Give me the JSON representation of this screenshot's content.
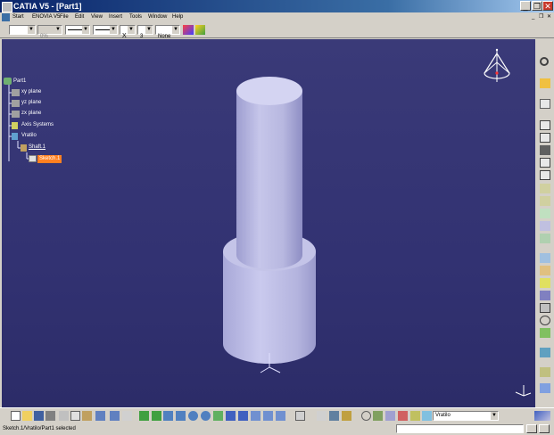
{
  "window": {
    "title": "CATIA V5 - [Part1]",
    "minimize_label": "_",
    "restore_label": "❐",
    "close_label": "✕",
    "doc_minimize_label": "_",
    "doc_restore_label": "❐",
    "doc_close_label": "✕"
  },
  "menu": {
    "items": [
      "Start",
      "ENOVIA V5",
      "File",
      "Edit",
      "View",
      "Insert",
      "Tools",
      "Window",
      "Help"
    ]
  },
  "toolbar_top": {
    "combo1_value": "",
    "combo2_value": "0%",
    "combo3_value": "",
    "combo4_value": "",
    "combo5_value": "3",
    "combo6_value": "None",
    "x_button": "X"
  },
  "tree": {
    "root": "Part1",
    "items": [
      "xy plane",
      "yz plane",
      "zx plane",
      "Axis Systems",
      "Vratilo",
      "Shaft.1",
      "Sketch.1"
    ]
  },
  "bottom_toolbar": {
    "combo_value": "Vratilo"
  },
  "status": {
    "message": "Sketch.1/Vratilo/Part1 selected"
  },
  "colors": {
    "viewport_bg": "#34346f",
    "part_body": "#c8c8e8",
    "selection": "#ff8020"
  }
}
